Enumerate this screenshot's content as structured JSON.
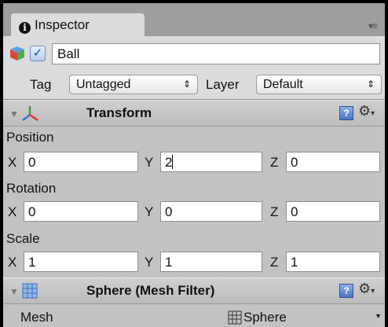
{
  "inspector": {
    "tab_label": "Inspector",
    "menu_icon": "list-menu-icon"
  },
  "object": {
    "icon": "cube-icon",
    "active": true,
    "name": "Ball",
    "tag_label": "Tag",
    "tag_value": "Untagged",
    "layer_label": "Layer",
    "layer_value": "Default"
  },
  "transform": {
    "title": "Transform",
    "position_label": "Position",
    "position": {
      "x": "0",
      "y": "2",
      "z": "0"
    },
    "rotation_label": "Rotation",
    "rotation": {
      "x": "0",
      "y": "0",
      "z": "0"
    },
    "scale_label": "Scale",
    "scale": {
      "x": "1",
      "y": "1",
      "z": "1"
    }
  },
  "axes": {
    "x": "X",
    "y": "Y",
    "z": "Z"
  },
  "mesh_filter": {
    "title": "Sphere (Mesh Filter)",
    "mesh_label": "Mesh",
    "mesh_value": "Sphere"
  },
  "colors": {
    "panel_bg": "#c2c2c2",
    "tab_bar": "#9d9d9d",
    "help_blue": "#4b72c5"
  }
}
